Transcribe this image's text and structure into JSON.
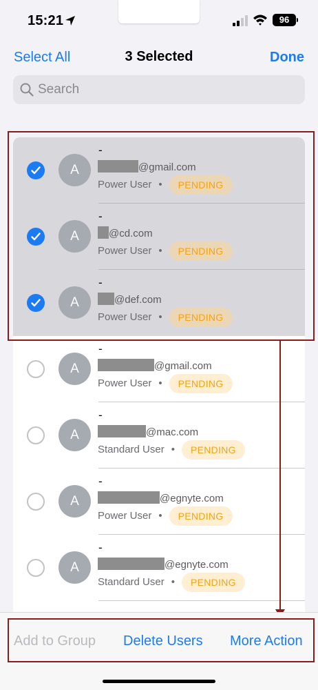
{
  "status_bar": {
    "time": "15:21",
    "battery": "96",
    "icons": [
      "location-arrow-icon",
      "signal-icon",
      "wifi-icon",
      "battery-icon"
    ]
  },
  "nav": {
    "select_all": "Select All",
    "title": "3 Selected",
    "done": "Done"
  },
  "search": {
    "placeholder": "Search",
    "value": ""
  },
  "users": [
    {
      "name": "-",
      "avatar": "A",
      "email_domain": "@gmail.com",
      "role": "Power User",
      "status": "PENDING",
      "selected": true
    },
    {
      "name": "-",
      "avatar": "A",
      "email_domain": "@cd.com",
      "role": "Power User",
      "status": "PENDING",
      "selected": true
    },
    {
      "name": "-",
      "avatar": "A",
      "email_domain": "@def.com",
      "role": "Power User",
      "status": "PENDING",
      "selected": true
    },
    {
      "name": "-",
      "avatar": "A",
      "email_domain": "@gmail.com",
      "role": "Power User",
      "status": "PENDING",
      "selected": false
    },
    {
      "name": "-",
      "avatar": "A",
      "email_domain": "@mac.com",
      "role": "Standard User",
      "status": "PENDING",
      "selected": false
    },
    {
      "name": "-",
      "avatar": "A",
      "email_domain": "@egnyte.com",
      "role": "Power User",
      "status": "PENDING",
      "selected": false
    },
    {
      "name": "-",
      "avatar": "A",
      "email_domain": "@egnyte.com",
      "role": "Standard User",
      "status": "PENDING",
      "selected": false
    }
  ],
  "separator": "•",
  "toolbar": {
    "add_to_group": "Add to Group",
    "delete_users": "Delete Users",
    "more_action": "More Action"
  },
  "colors": {
    "accent": "#1a7bf2",
    "pending_text": "#f2a21a",
    "pending_bg": "#feefd3",
    "selected_row": "#d7d7dc",
    "annotation": "#8b1a1a"
  }
}
